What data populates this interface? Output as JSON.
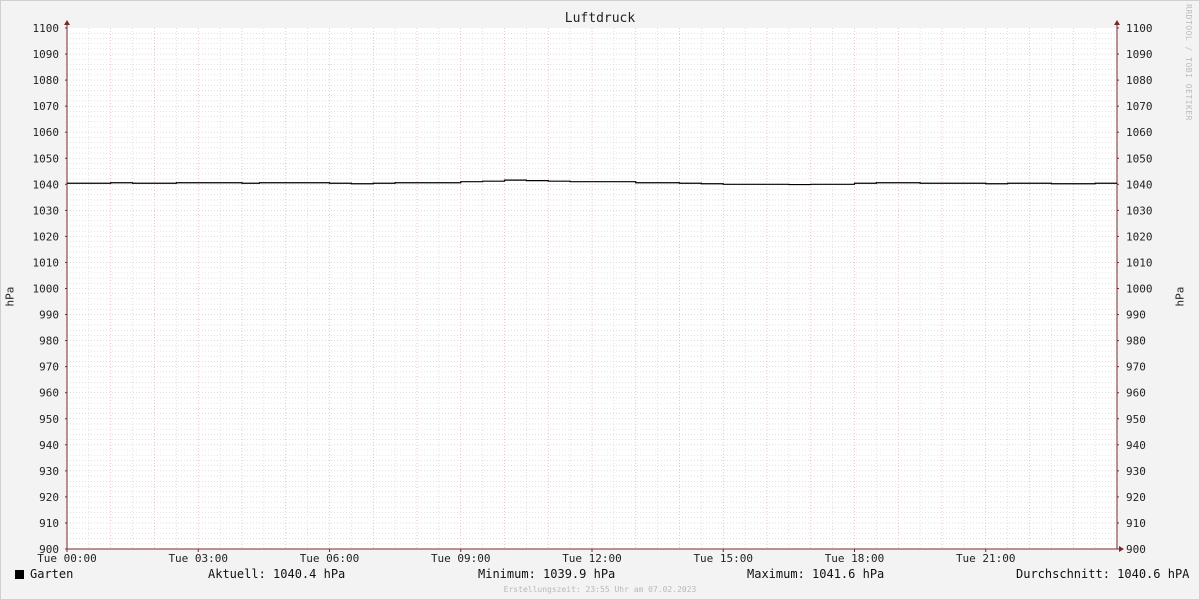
{
  "chart_data": {
    "type": "line",
    "title": "Luftdruck",
    "ylabel": "hPa",
    "ylim": [
      900,
      1100
    ],
    "y_ticks": [
      "900",
      "910",
      "920",
      "930",
      "940",
      "950",
      "960",
      "970",
      "980",
      "990",
      "1000",
      "1010",
      "1020",
      "1030",
      "1040",
      "1050",
      "1060",
      "1070",
      "1080",
      "1090",
      "1100"
    ],
    "x_ticks": [
      "Tue 00:00",
      "Tue 03:00",
      "Tue 06:00",
      "Tue 09:00",
      "Tue 12:00",
      "Tue 15:00",
      "Tue 18:00",
      "Tue 21:00"
    ],
    "x_hours": [
      0,
      3,
      6,
      9,
      12,
      15,
      18,
      21
    ],
    "xlim_hours": [
      0,
      24
    ],
    "grid": true,
    "series": [
      {
        "name": "Garten",
        "color": "#000000",
        "x_hours": [
          0,
          1.0,
          1.5,
          2.2,
          2.5,
          3.5,
          4.0,
          4.4,
          4.8,
          5.5,
          6.0,
          6.5,
          7.0,
          7.5,
          8.0,
          8.5,
          9.0,
          9.5,
          10.0,
          10.5,
          11.0,
          11.5,
          12.0,
          12.5,
          13.0,
          13.5,
          14.0,
          14.5,
          15.0,
          15.5,
          16.0,
          16.5,
          17.0,
          17.5,
          18.0,
          18.5,
          19.0,
          19.5,
          20.0,
          20.5,
          21.0,
          21.5,
          22.0,
          22.5,
          23.0,
          23.5,
          24.0
        ],
        "values": [
          1040.4,
          1040.6,
          1040.4,
          1040.4,
          1040.6,
          1040.6,
          1040.4,
          1040.6,
          1040.6,
          1040.6,
          1040.4,
          1040.2,
          1040.4,
          1040.6,
          1040.6,
          1040.6,
          1041.0,
          1041.2,
          1041.6,
          1041.4,
          1041.2,
          1041.0,
          1041.0,
          1041.0,
          1040.6,
          1040.6,
          1040.4,
          1040.2,
          1040.0,
          1040.0,
          1040.0,
          1039.9,
          1040.0,
          1040.0,
          1040.4,
          1040.6,
          1040.6,
          1040.4,
          1040.4,
          1040.4,
          1040.2,
          1040.4,
          1040.4,
          1040.2,
          1040.2,
          1040.4,
          1040.4
        ]
      }
    ]
  },
  "legend": {
    "series_name": "Garten",
    "current": "Aktuell: 1040.4 hPa",
    "minimum": "Minimum: 1039.9 hPa",
    "maximum": "Maximum: 1041.6 hPa",
    "average": "Durchschnitt: 1040.6 hPA"
  },
  "watermark": "RRDTOOL / TOBI OETIKER",
  "footer": "Erstellungszeit: 23:55 Uhr am 07.02.2023",
  "colors": {
    "background": "#f3f3f3",
    "plot_background": "#ffffff",
    "minor_grid": "#d0d0d0",
    "major_grid_vertical": "#e3a0a0",
    "axis": "#7a2a2a",
    "line": "#000000"
  }
}
